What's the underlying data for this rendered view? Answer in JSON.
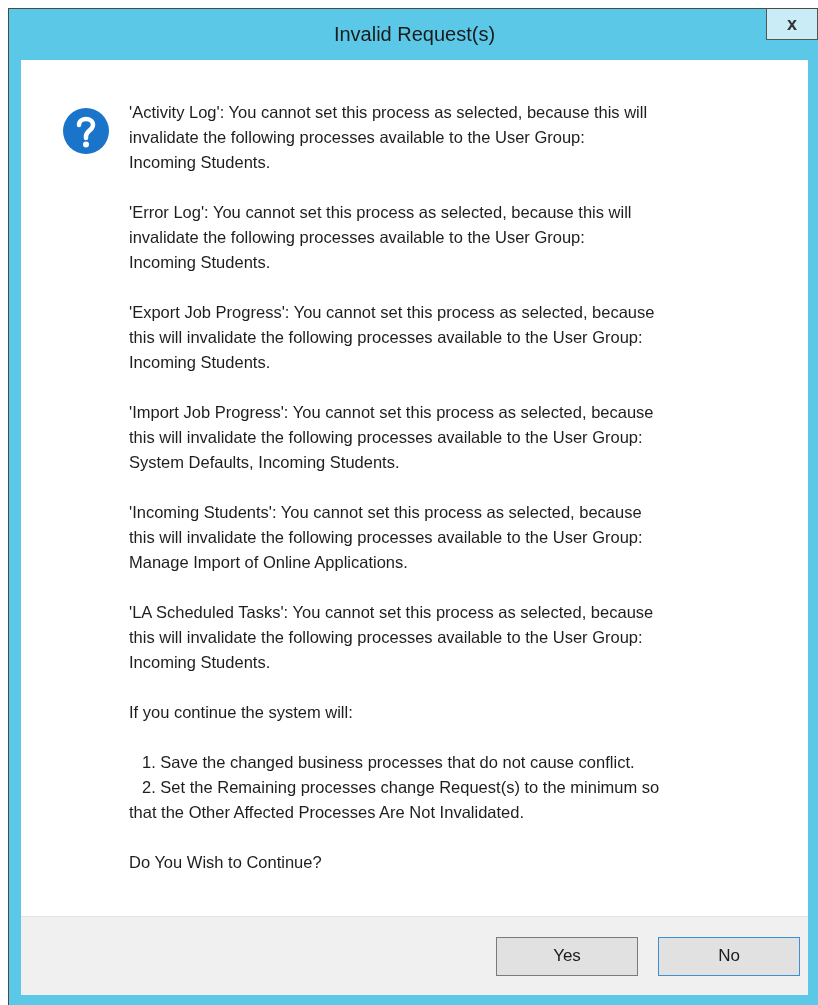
{
  "window": {
    "title": "Invalid Request(s)",
    "close_label": "x"
  },
  "message": {
    "paragraphs": [
      "'Activity Log': You cannot set this process as selected, because this will\ninvalidate the following processes available to the User Group:\nIncoming Students.",
      "'Error Log': You cannot set this process as selected, because this will\ninvalidate the following processes available to the User Group:\nIncoming Students.",
      "'Export Job Progress': You cannot set this process as selected, because\nthis will invalidate the following processes available to the User Group:\nIncoming Students.",
      "'Import Job Progress': You cannot set this process as selected, because\nthis will invalidate the following processes available to the User Group:\nSystem Defaults, Incoming Students.",
      "'Incoming Students': You cannot set this process as selected, because\nthis will invalidate the following processes available to the User Group:\nManage Import of Online Applications.",
      "'LA Scheduled Tasks': You cannot set this process as selected, because\nthis will invalidate the following processes available to the User Group:\nIncoming Students."
    ],
    "intro": "If you continue the system will:",
    "steps": [
      "1. Save the changed business processes that do not cause conflict.",
      "2. Set the Remaining processes change Request(s) to the minimum so\nthat the Other Affected Processes Are Not Invalidated."
    ],
    "question": "Do You Wish to Continue?"
  },
  "buttons": [
    {
      "label": "Yes",
      "default": false
    },
    {
      "label": "No",
      "default": true
    }
  ]
}
